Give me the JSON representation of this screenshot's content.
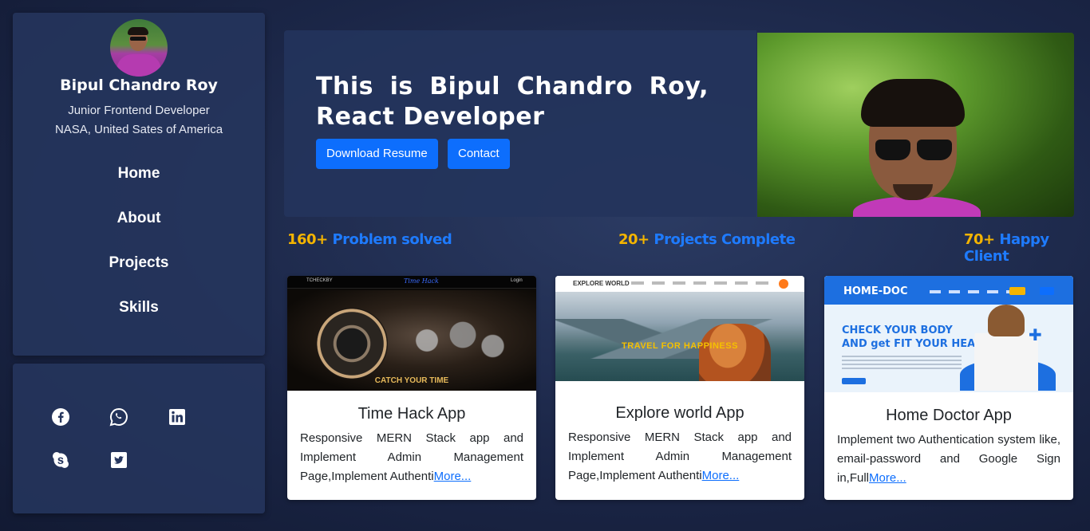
{
  "profile": {
    "name": "Bipul Chandro Roy",
    "role": "Junior Frontend Developer",
    "location": "NASA, United Sates of America"
  },
  "nav": {
    "items": [
      {
        "label": "Home"
      },
      {
        "label": "About"
      },
      {
        "label": "Projects"
      },
      {
        "label": "Skills"
      }
    ]
  },
  "social": {
    "icons": [
      "facebook-icon",
      "whatsapp-icon",
      "linkedin-icon",
      "skype-icon",
      "twitter-icon"
    ]
  },
  "hero": {
    "title": "This is Bipul Chandro Roy, React Developer",
    "download_label": "Download Resume",
    "contact_label": "Contact"
  },
  "stats": [
    {
      "num": "160+",
      "label": "Problem solved"
    },
    {
      "num": "20+",
      "label": "Projects Complete"
    },
    {
      "num": "70+",
      "label": "Happy Client"
    }
  ],
  "projects": [
    {
      "title": "Time Hack App",
      "desc": "Responsive MERN Stack app and Implement Admin Management Page,Implement Authenti",
      "more": "More...",
      "thumb": {
        "brand": "Time Hack",
        "tagline": "CATCH YOUR TIME"
      }
    },
    {
      "title": "Explore world App",
      "desc": "Responsive MERN Stack app and Implement Admin Management Page,Implement Authenti",
      "more": "More...",
      "thumb": {
        "brand": "EXPLORE WORLD",
        "tagline": "TRAVEL FOR HAPPINESS"
      }
    },
    {
      "title": "Home Doctor App",
      "desc": "Implement two Authentication system like, email-password and Google Sign in,Full",
      "more": "More...",
      "thumb": {
        "brand": "HOME-DOC",
        "headline_1": "CHECK YOUR BODY",
        "headline_2": "AND get FIT YOUR HEALTH"
      }
    }
  ],
  "colors": {
    "accent": "#0d6efd",
    "stat_number": "#f4b400",
    "stat_label": "#1e7bff",
    "panel": "#26365e"
  }
}
